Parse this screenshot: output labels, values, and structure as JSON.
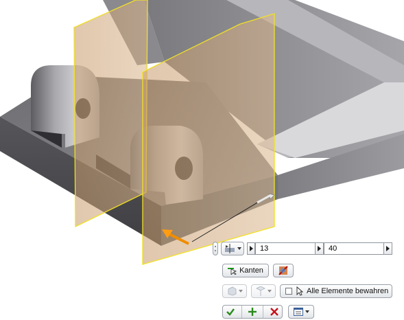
{
  "toolbar": {
    "value1": "13",
    "value2": "40",
    "edges_label": "Kanten",
    "keep_all_label": "Alle Elemente bewahren"
  },
  "icons": [
    "split-method-icon",
    "edges-select-icon",
    "flip-side-icon",
    "body-select-icon",
    "tool-select-icon",
    "cursor-icon",
    "ok-icon",
    "apply-icon",
    "cancel-icon",
    "options-menu-icon"
  ],
  "colors": {
    "plane_outline": "#f2e025",
    "ok": "#2b8a1c",
    "cancel": "#c8101a"
  }
}
